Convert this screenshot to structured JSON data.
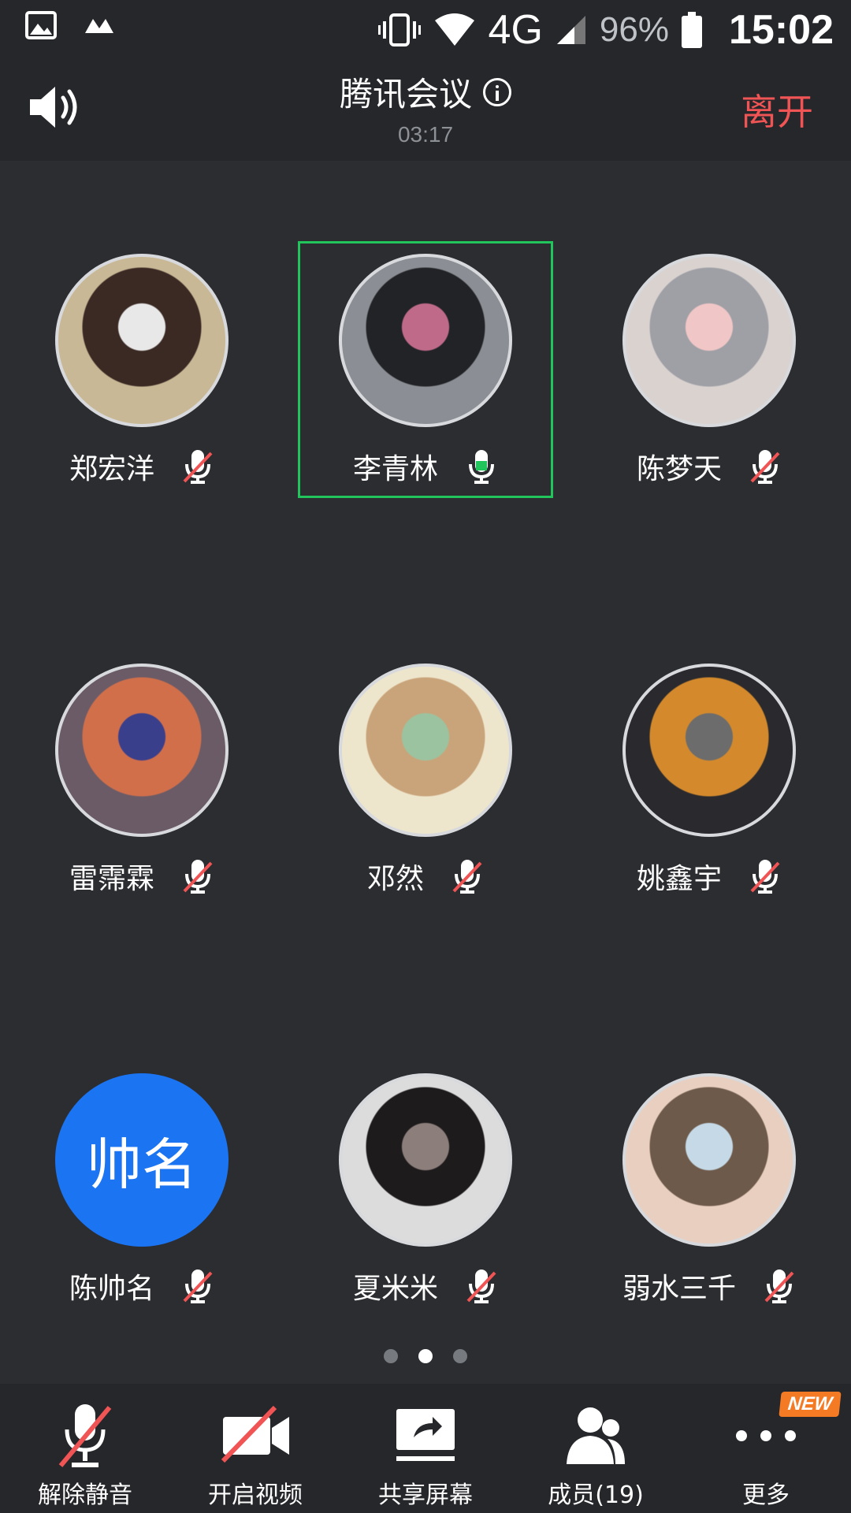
{
  "status_bar": {
    "network": "4G",
    "battery": "96%",
    "time": "15:02"
  },
  "header": {
    "title": "腾讯会议",
    "elapsed": "03:17",
    "leave": "离开"
  },
  "participants": [
    {
      "name": "郑宏洋",
      "muted": true,
      "speaking": false,
      "avatar": "photo",
      "colors": [
        "#c9b896",
        "#3b2a24",
        "#e8e8e8"
      ]
    },
    {
      "name": "李青林",
      "muted": false,
      "speaking": true,
      "avatar": "photo",
      "colors": [
        "#8b8f95",
        "#222326",
        "#c06a8a"
      ]
    },
    {
      "name": "陈梦天",
      "muted": true,
      "speaking": false,
      "avatar": "photo",
      "colors": [
        "#d9d2cf",
        "#9fa0a6",
        "#f0c6c6"
      ]
    },
    {
      "name": "雷霈霖",
      "muted": true,
      "speaking": false,
      "avatar": "photo",
      "colors": [
        "#6a5b66",
        "#d26f4b",
        "#3a3f8c"
      ]
    },
    {
      "name": "邓然",
      "muted": true,
      "speaking": false,
      "avatar": "photo",
      "colors": [
        "#eee6cc",
        "#c9a47b",
        "#9bc39f"
      ]
    },
    {
      "name": "姚鑫宇",
      "muted": true,
      "speaking": false,
      "avatar": "photo",
      "colors": [
        "#2a2a2e",
        "#d48a2c",
        "#6c6c6c"
      ]
    },
    {
      "name": "陈帅名",
      "muted": true,
      "speaking": false,
      "avatar": "letter",
      "initials": "帅名",
      "colors": [
        "#1b74f2"
      ]
    },
    {
      "name": "夏米米",
      "muted": true,
      "speaking": false,
      "avatar": "photo",
      "colors": [
        "#dcdcdc",
        "#1e1b1d",
        "#8c7e7a"
      ]
    },
    {
      "name": "弱水三千",
      "muted": true,
      "speaking": false,
      "avatar": "photo",
      "colors": [
        "#e9cfc0",
        "#6e5a4a",
        "#c5d9e7"
      ]
    }
  ],
  "pagination": {
    "pages": 3,
    "current": 2
  },
  "toolbar": {
    "unmute": "解除静音",
    "video": "开启视频",
    "share": "共享屏幕",
    "members": "成员(19)",
    "more": "更多",
    "new_badge": "NEW"
  },
  "colors": {
    "accent_speaking": "#21c55b",
    "leave": "#f05454",
    "muted_slash": "#f05454",
    "letter_avatar": "#1b74f2",
    "new_badge": "#f47a24"
  }
}
